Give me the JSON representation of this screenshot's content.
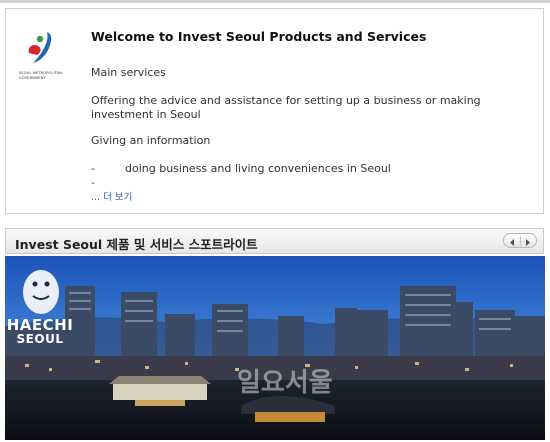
{
  "card": {
    "logo_text_line1": "SEOUL METROPOLITAN",
    "logo_text_line2": "GOVERNMENT",
    "title": "Welcome to Invest Seoul Products and Services",
    "main_services": "Main services",
    "paragraph": "Offering the advice and assistance for setting up a business or making investment in Seoul",
    "giving_info": "Giving an information",
    "bullet1_dash": "-",
    "bullet1_text": "doing business and living conveniences in Seoul",
    "bullet2_dash": "-",
    "more_link": "... 더 보기"
  },
  "spotlight": {
    "title": "Invest Seoul 제품 및 서비스 스포트라이트",
    "prev_icon": "chevron-left-icon",
    "next_icon": "chevron-right-icon"
  },
  "banner": {
    "haechi_word": "HAECHI",
    "haechi_sub": "SEOUL",
    "watermark": "일요서울"
  },
  "colors": {
    "link": "#2b5ea7",
    "sky_top": "#1a54b8",
    "logo_red": "#d7282f",
    "logo_blue": "#1b6ab3",
    "logo_green": "#3a9b45"
  }
}
